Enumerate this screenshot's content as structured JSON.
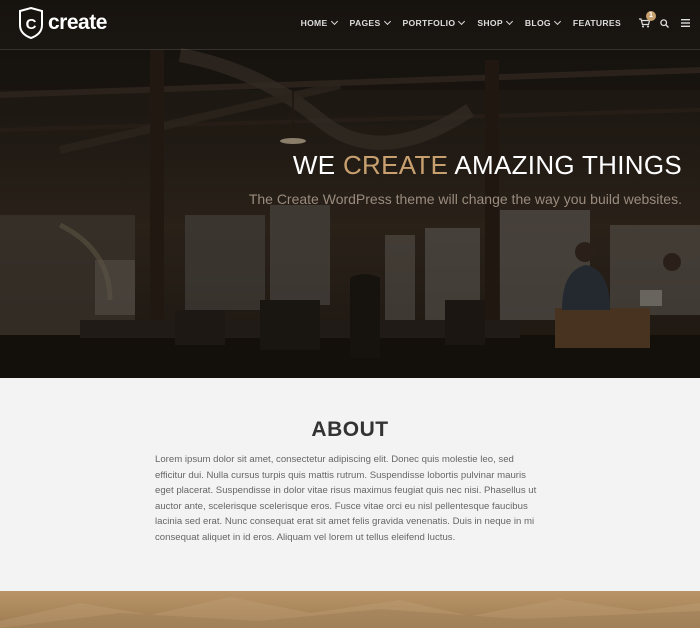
{
  "header": {
    "logo_letter": "C",
    "logo_text": "create",
    "nav": [
      {
        "label": "HOME",
        "dropdown": true
      },
      {
        "label": "PAGES",
        "dropdown": true
      },
      {
        "label": "PORTFOLIO",
        "dropdown": true
      },
      {
        "label": "SHOP",
        "dropdown": true
      },
      {
        "label": "BLOG",
        "dropdown": true
      },
      {
        "label": "FEATURES",
        "dropdown": false
      }
    ],
    "cart_count": "1",
    "icons": [
      "cart-icon",
      "search-icon",
      "menu-icon"
    ]
  },
  "hero": {
    "title_pre": "WE ",
    "title_accent": "CREATE",
    "title_post": " AMAZING THINGS",
    "subtitle": "The Create WordPress theme will change the way you build websites."
  },
  "about": {
    "title": "ABOUT",
    "body": "Lorem ipsum dolor sit amet, consectetur adipiscing elit. Donec quis molestie leo, sed efficitur dui. Nulla cursus turpis quis mattis rutrum. Suspendisse lobortis pulvinar mauris eget placerat. Suspendisse in dolor vitae risus maximus feugiat quis nec nisi. Phasellus ut auctor ante, scelerisque scelerisque eros. Fusce vitae orci eu nisl pellentesque faucibus lacinia sed erat. Nunc consequat erat sit amet felis gravida venenatis. Duis in neque in mi consequat aliquet in id eros. Aliquam vel lorem ut tellus eleifend luctus."
  },
  "colors": {
    "accent": "#c8a070",
    "hero_dark": "#231c16",
    "section_bg": "#f3f3f3",
    "band": "#b89468"
  }
}
